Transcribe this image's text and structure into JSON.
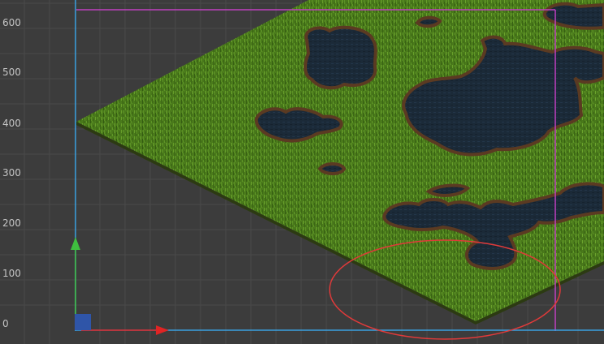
{
  "editor": {
    "y_axis_labels": [
      "600",
      "500",
      "400",
      "300",
      "200",
      "100",
      "0"
    ]
  },
  "colors": {
    "background": "#3c3c3c",
    "grid_line": "#4a4a4a",
    "x_axis": "#e02424",
    "y_axis": "#3fbf3f",
    "axis_line": "#3aa0e0",
    "bounds_line": "#c040c0",
    "selection_ellipse": "#e03a3a",
    "grass_dark": "#3f6a16",
    "grass_light": "#5b8f22",
    "water": "#1b2a38",
    "mud": "#5b3a22",
    "origin_square": "#2f55a8"
  },
  "icons": {
    "x_arrow": "arrow-right-icon",
    "y_arrow": "arrow-up-icon",
    "origin": "origin-square-icon"
  }
}
